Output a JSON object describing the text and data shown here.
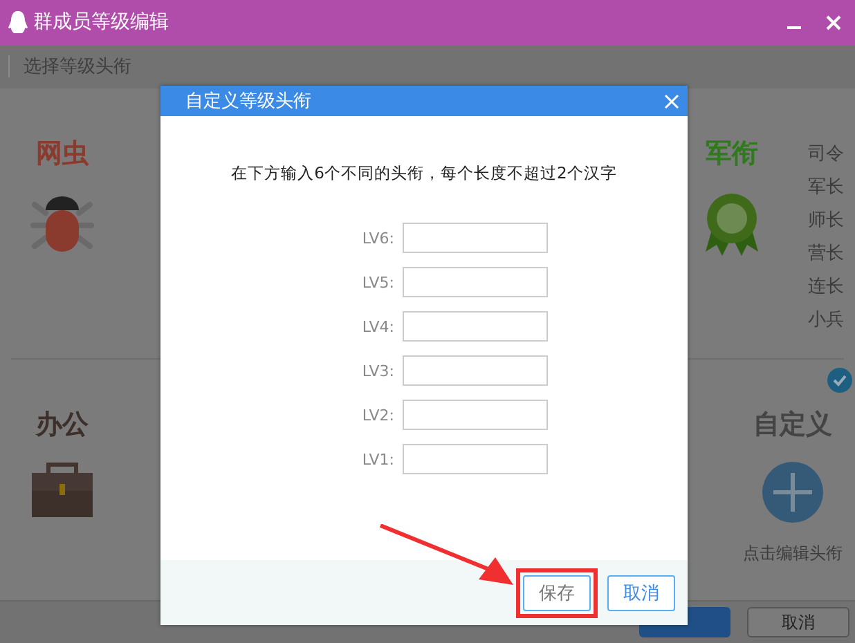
{
  "window": {
    "title": "群成员等级编辑"
  },
  "toolbar": {
    "label": "选择等级头衔"
  },
  "categories": [
    {
      "title": "网虫",
      "kind": "bug",
      "color": "#8b3a2e"
    },
    {
      "title": "军衔",
      "kind": "medal",
      "color": "#2f7a1c",
      "titles": [
        "司令",
        "军长",
        "师长",
        "营长",
        "连长",
        "小兵"
      ]
    },
    {
      "title": "办公",
      "kind": "briefcase",
      "color": "#3d2f2a"
    },
    {
      "title": "自定义",
      "kind": "custom",
      "color": "#444444",
      "selected": true,
      "action": "点击编辑头衔"
    }
  ],
  "footer": {
    "buttons": [
      {
        "kind": "primary"
      },
      {
        "kind": "plain",
        "label": "取消"
      }
    ]
  },
  "dialog": {
    "title": "自定义等级头衔",
    "instruction": "在下方输入6个不同的头衔，每个长度不超过2个汉字",
    "fields": [
      {
        "label": "LV6:"
      },
      {
        "label": "LV5:"
      },
      {
        "label": "LV4:"
      },
      {
        "label": "LV3:"
      },
      {
        "label": "LV2:"
      },
      {
        "label": "LV1:"
      }
    ],
    "buttons": [
      {
        "label": "保存",
        "highlighted": true
      },
      {
        "label": "取消",
        "highlighted": false
      }
    ]
  }
}
